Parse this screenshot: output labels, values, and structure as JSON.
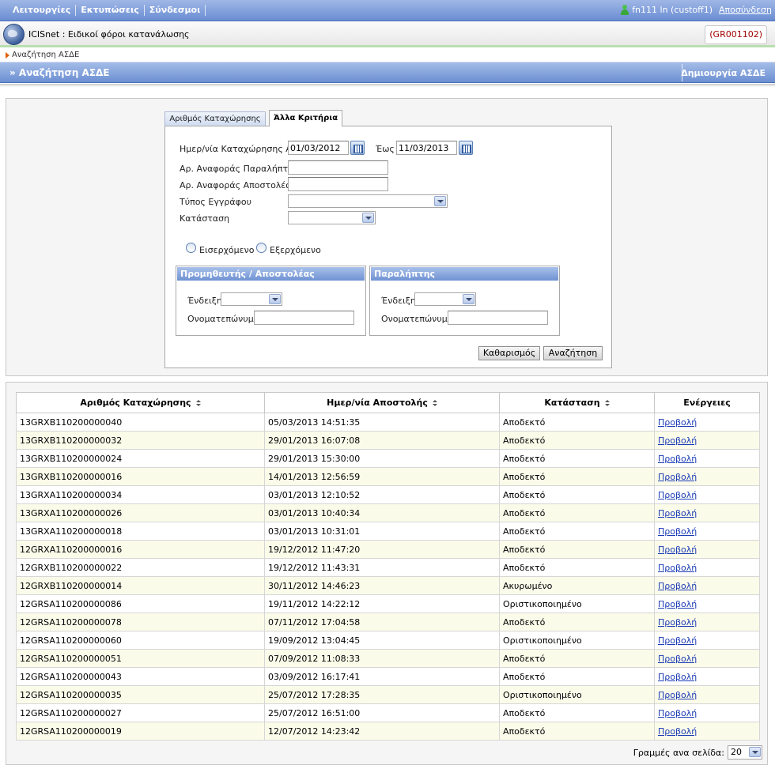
{
  "menu": {
    "items": [
      "Λειτουργίες",
      "Εκτυπώσεις",
      "Σύνδεσμοι"
    ],
    "user": "fn111 ln (custoff1)",
    "logout": "Αποσύνδεση"
  },
  "app": {
    "title": "ICISnet : Ειδικοί φόροι κατανάλωσης",
    "office_code": "(GR001102)"
  },
  "breadcrumb": "Αναζήτηση ΑΣΔΕ",
  "page": {
    "title": "» Αναζήτηση ΑΣΔΕ",
    "create_link": "Δημιουργία ΑΣΔΕ"
  },
  "tabs": [
    "Αριθμός Καταχώρησης",
    "Άλλα Κριτήρια"
  ],
  "form": {
    "date_from_label": "Ημερ/νία Καταχώρησης Από",
    "date_from": "01/03/2012",
    "date_to_label": "Έως",
    "date_to": "11/03/2013",
    "receiver_ref_label": "Αρ. Αναφοράς Παραλήπτη",
    "sender_ref_label": "Αρ. Αναφοράς Αποστολέα",
    "doc_type_label": "Τύπος Εγγράφου",
    "status_label": "Κατάσταση",
    "incoming_label": "Εισερχόμενο",
    "outgoing_label": "Εξερχόμενο",
    "supplier_legend": "Προμηθευτής / Αποστολέας",
    "receiver_legend": "Παραλήπτης",
    "indication_label": "Ένδειξη",
    "fullname_label": "Ονοματεπώνυμο",
    "clear_button": "Καθαρισμός",
    "search_button": "Αναζήτηση"
  },
  "table": {
    "headers": [
      "Αριθμός Καταχώρησης",
      "Ημερ/νία Αποστολής",
      "Κατάσταση",
      "Ενέργειες"
    ],
    "view_label": "Προβολή",
    "rows": [
      [
        "13GRXB110200000040",
        "05/03/2013 14:51:35",
        "Αποδεκτό"
      ],
      [
        "13GRXB110200000032",
        "29/01/2013 16:07:08",
        "Αποδεκτό"
      ],
      [
        "13GRXB110200000024",
        "29/01/2013 15:30:00",
        "Αποδεκτό"
      ],
      [
        "13GRXB110200000016",
        "14/01/2013 12:56:59",
        "Αποδεκτό"
      ],
      [
        "13GRXA110200000034",
        "03/01/2013 12:10:52",
        "Αποδεκτό"
      ],
      [
        "13GRXA110200000026",
        "03/01/2013 10:40:34",
        "Αποδεκτό"
      ],
      [
        "13GRXA110200000018",
        "03/01/2013 10:31:01",
        "Αποδεκτό"
      ],
      [
        "12GRXA110200000016",
        "19/12/2012 11:47:20",
        "Αποδεκτό"
      ],
      [
        "12GRXB110200000022",
        "19/12/2012 11:43:31",
        "Αποδεκτό"
      ],
      [
        "12GRXB110200000014",
        "30/11/2012 14:46:23",
        "Ακυρωμένο"
      ],
      [
        "12GRSA110200000086",
        "19/11/2012 14:22:12",
        "Οριστικοποιημένο"
      ],
      [
        "12GRSA110200000078",
        "07/11/2012 17:04:58",
        "Αποδεκτό"
      ],
      [
        "12GRSA110200000060",
        "19/09/2012 13:04:45",
        "Οριστικοποιημένο"
      ],
      [
        "12GRSA110200000051",
        "07/09/2012 11:08:33",
        "Αποδεκτό"
      ],
      [
        "12GRSA110200000043",
        "03/09/2012 16:17:41",
        "Αποδεκτό"
      ],
      [
        "12GRSA110200000035",
        "25/07/2012 17:28:35",
        "Οριστικοποιημένο"
      ],
      [
        "12GRSA110200000027",
        "25/07/2012 16:51:00",
        "Αποδεκτό"
      ],
      [
        "12GRSA110200000019",
        "12/07/2012 14:23:42",
        "Αποδεκτό"
      ]
    ]
  },
  "pager": {
    "label": "Γραμμές ανα σελίδα:",
    "value": "20"
  }
}
